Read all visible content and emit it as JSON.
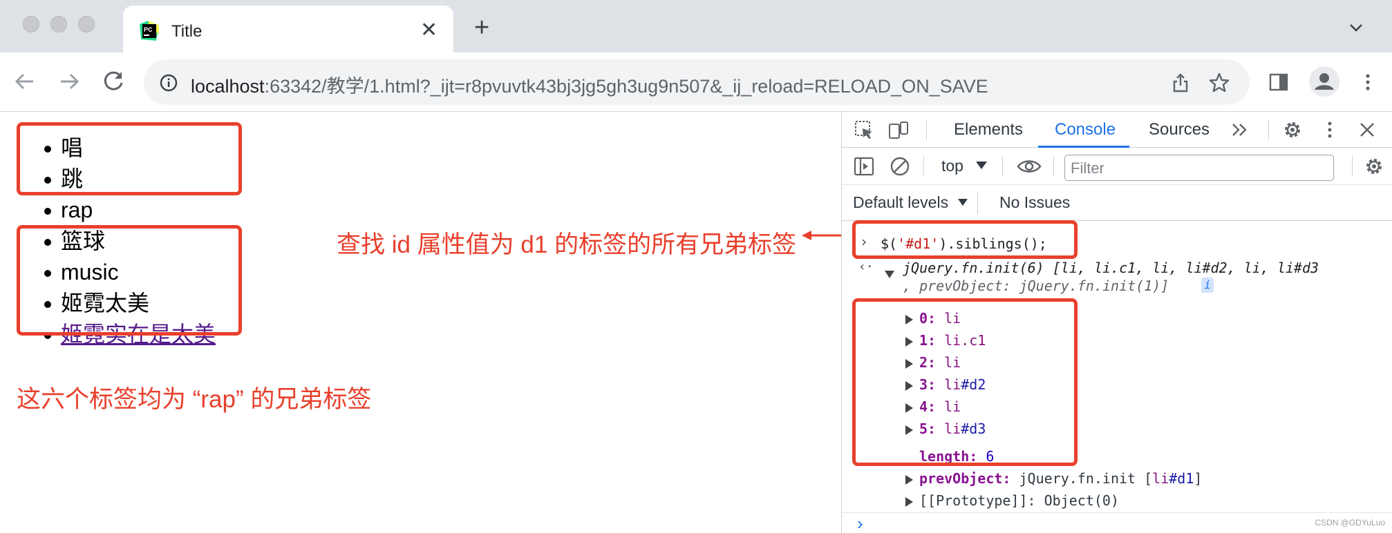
{
  "browser": {
    "tab_title": "Title",
    "url_host": "localhost",
    "url_rest": ":63342/教学/1.html?_ijt=r8pvuvtk43bj3jg5gh3ug9n507&_ij_reload=RELOAD_ON_SAVE",
    "icons": {
      "favicon": "pycharm-icon",
      "close_tab": "close-icon",
      "new_tab": "plus-icon",
      "tab_menu": "chevron-down-icon",
      "back": "arrow-left-icon",
      "forward": "arrow-right-icon",
      "reload": "reload-icon",
      "site_info": "info-icon",
      "share": "share-icon",
      "bookmark": "star-icon",
      "side_panel": "side-panel-icon",
      "profile": "avatar-icon",
      "menu": "kebab-icon"
    }
  },
  "page": {
    "list": [
      {
        "text": "唱",
        "link": false
      },
      {
        "text": "跳",
        "link": false
      },
      {
        "text": "rap",
        "link": false
      },
      {
        "text": "篮球",
        "link": false
      },
      {
        "text": "music",
        "link": false
      },
      {
        "text": "姬霓太美",
        "link": false
      },
      {
        "text": "姬霓实在是太美",
        "link": true
      }
    ],
    "annotation_siblings": "这六个标签均为 “rap” 的兄弟标签",
    "annotation_query": "查找 id 属性值为 d1 的标签的所有兄弟标签",
    "accent_color": "#e8402c"
  },
  "devtools": {
    "tabs": [
      "Elements",
      "Console",
      "Sources"
    ],
    "active_tab": "Console",
    "context": "top",
    "filter_placeholder": "Filter",
    "levels": "Default levels",
    "issues": "No Issues",
    "command": "$('#d1').siblings();",
    "result_header_1": "jQuery.fn.init(6) [li, li.c1, li, li#d2, li, li#d3",
    "result_header_2": ", prevObject: jQuery.fn.init(1)]",
    "items": [
      {
        "key": "0:",
        "tag": "li",
        "suffix": ""
      },
      {
        "key": "1:",
        "tag": "li.c1",
        "suffix": ""
      },
      {
        "key": "2:",
        "tag": "li",
        "suffix": ""
      },
      {
        "key": "3:",
        "tag": "li",
        "suffix": "#d2"
      },
      {
        "key": "4:",
        "tag": "li",
        "suffix": ""
      },
      {
        "key": "5:",
        "tag": "li",
        "suffix": "#d3"
      }
    ],
    "length_key": "length:",
    "length_val": "6",
    "prev_key": "prevObject:",
    "prev_val_1": "jQuery.fn.init [",
    "prev_val_tag": "li",
    "prev_val_id": "#d1",
    "prev_val_end": "]",
    "proto": "[[Prototype]]: Object(0)"
  },
  "watermark": "CSDN @GDYuLuo"
}
